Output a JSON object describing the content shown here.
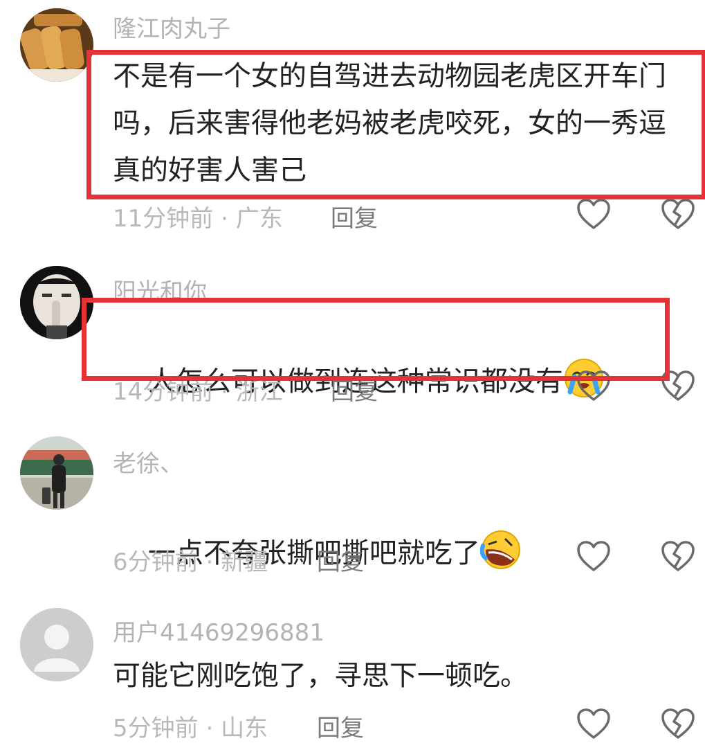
{
  "comments": [
    {
      "username": "隆江肉丸子",
      "text": "不是有一个女的自驾进去动物园老虎区开车门吗，后来害得他老妈被老虎咬死，女的一秀逗真的好害人害己",
      "time": "11分钟前",
      "location": "广东",
      "reply_label": "回复",
      "avatar_icon": "food-avatar-icon",
      "highlighted": true
    },
    {
      "username": "阳光和你",
      "text": "人怎么可以做到连这种常识都没有",
      "emoji": "crying-face-emoji",
      "time": "14分钟前",
      "location": "浙江",
      "reply_label": "回复",
      "avatar_icon": "person-avatar-icon",
      "highlighted": true
    },
    {
      "username": "老徐、",
      "text": "一点不夸张撕吧撕吧就吃了",
      "emoji": "laughing-face-emoji",
      "time": "6分钟前",
      "location": "新疆",
      "reply_label": "回复",
      "avatar_icon": "station-avatar-icon",
      "highlighted": false
    },
    {
      "username": "用户41469296881",
      "text": "可能它刚吃饱了，寻思下一顿吃。",
      "time": "5分钟前",
      "location": "山东",
      "reply_label": "回复",
      "avatar_icon": "default-user-avatar-icon",
      "highlighted": false
    }
  ],
  "separator": " · ",
  "colors": {
    "highlight": "#e53238",
    "meta_text": "#b8b8b8",
    "body_text": "#222222"
  }
}
